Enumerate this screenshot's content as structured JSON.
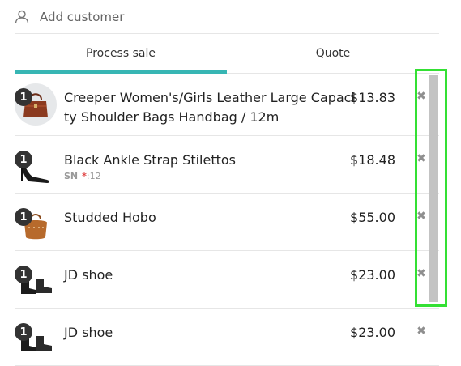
{
  "customer": {
    "add_label": "Add customer",
    "icon": "user-icon"
  },
  "tabs": [
    {
      "label": "Process sale",
      "active": true
    },
    {
      "label": "Quote",
      "active": false
    }
  ],
  "accent_color": "#37b6b4",
  "highlight_color": "#34e034",
  "items": [
    {
      "qty": "1",
      "name": "Creeper Women's/Girls Leather Large Capacity Shoulder Bags Handbag / 12m",
      "price": "$13.83",
      "image_icon": "handbag-icon"
    },
    {
      "qty": "1",
      "name": "Black Ankle Strap Stilettos",
      "price": "$18.48",
      "sn_label": "SN",
      "sn_star": "*",
      "sn_value": ":12",
      "image_icon": "stiletto-icon"
    },
    {
      "qty": "1",
      "name": "Studded Hobo",
      "price": "$55.00",
      "image_icon": "hobo-bag-icon"
    },
    {
      "qty": "1",
      "name": "JD shoe",
      "price": "$23.00",
      "image_icon": "boot-icon"
    },
    {
      "qty": "1",
      "name": "JD shoe",
      "price": "$23.00",
      "image_icon": "boot-icon"
    }
  ],
  "remove_glyph": "✖"
}
